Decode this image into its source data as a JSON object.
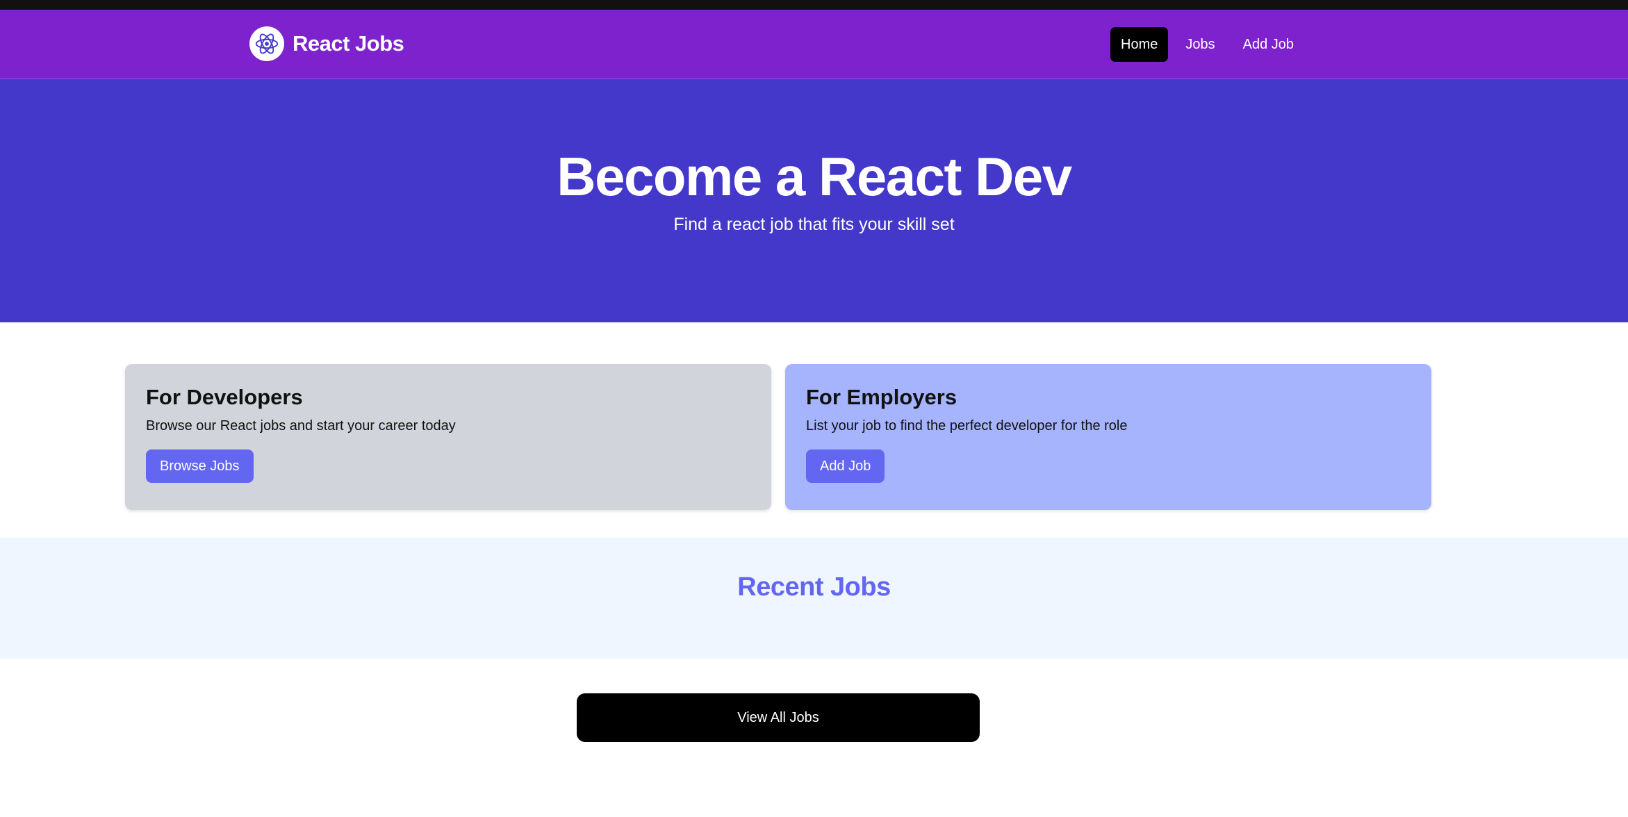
{
  "navbar": {
    "brand": "React Jobs",
    "links": [
      {
        "label": "Home",
        "active": true
      },
      {
        "label": "Jobs",
        "active": false
      },
      {
        "label": "Add Job",
        "active": false
      }
    ],
    "logo_icon": "react-atom-icon",
    "bg_color": "#7e22ce"
  },
  "hero": {
    "title": "Become a React Dev",
    "subtitle": "Find a react job that fits your skill set",
    "bg_color": "#4338ca"
  },
  "cards": {
    "developers": {
      "title": "For Developers",
      "text": "Browse our React jobs and start your career today",
      "button": "Browse Jobs"
    },
    "employers": {
      "title": "For Employers",
      "text": "List your job to find the perfect developer for the role",
      "button": "Add Job"
    }
  },
  "recent": {
    "title": "Recent Jobs"
  },
  "view_all": {
    "label": "View All Jobs"
  },
  "colors": {
    "accent": "#6366f1",
    "dark": "#000000"
  }
}
